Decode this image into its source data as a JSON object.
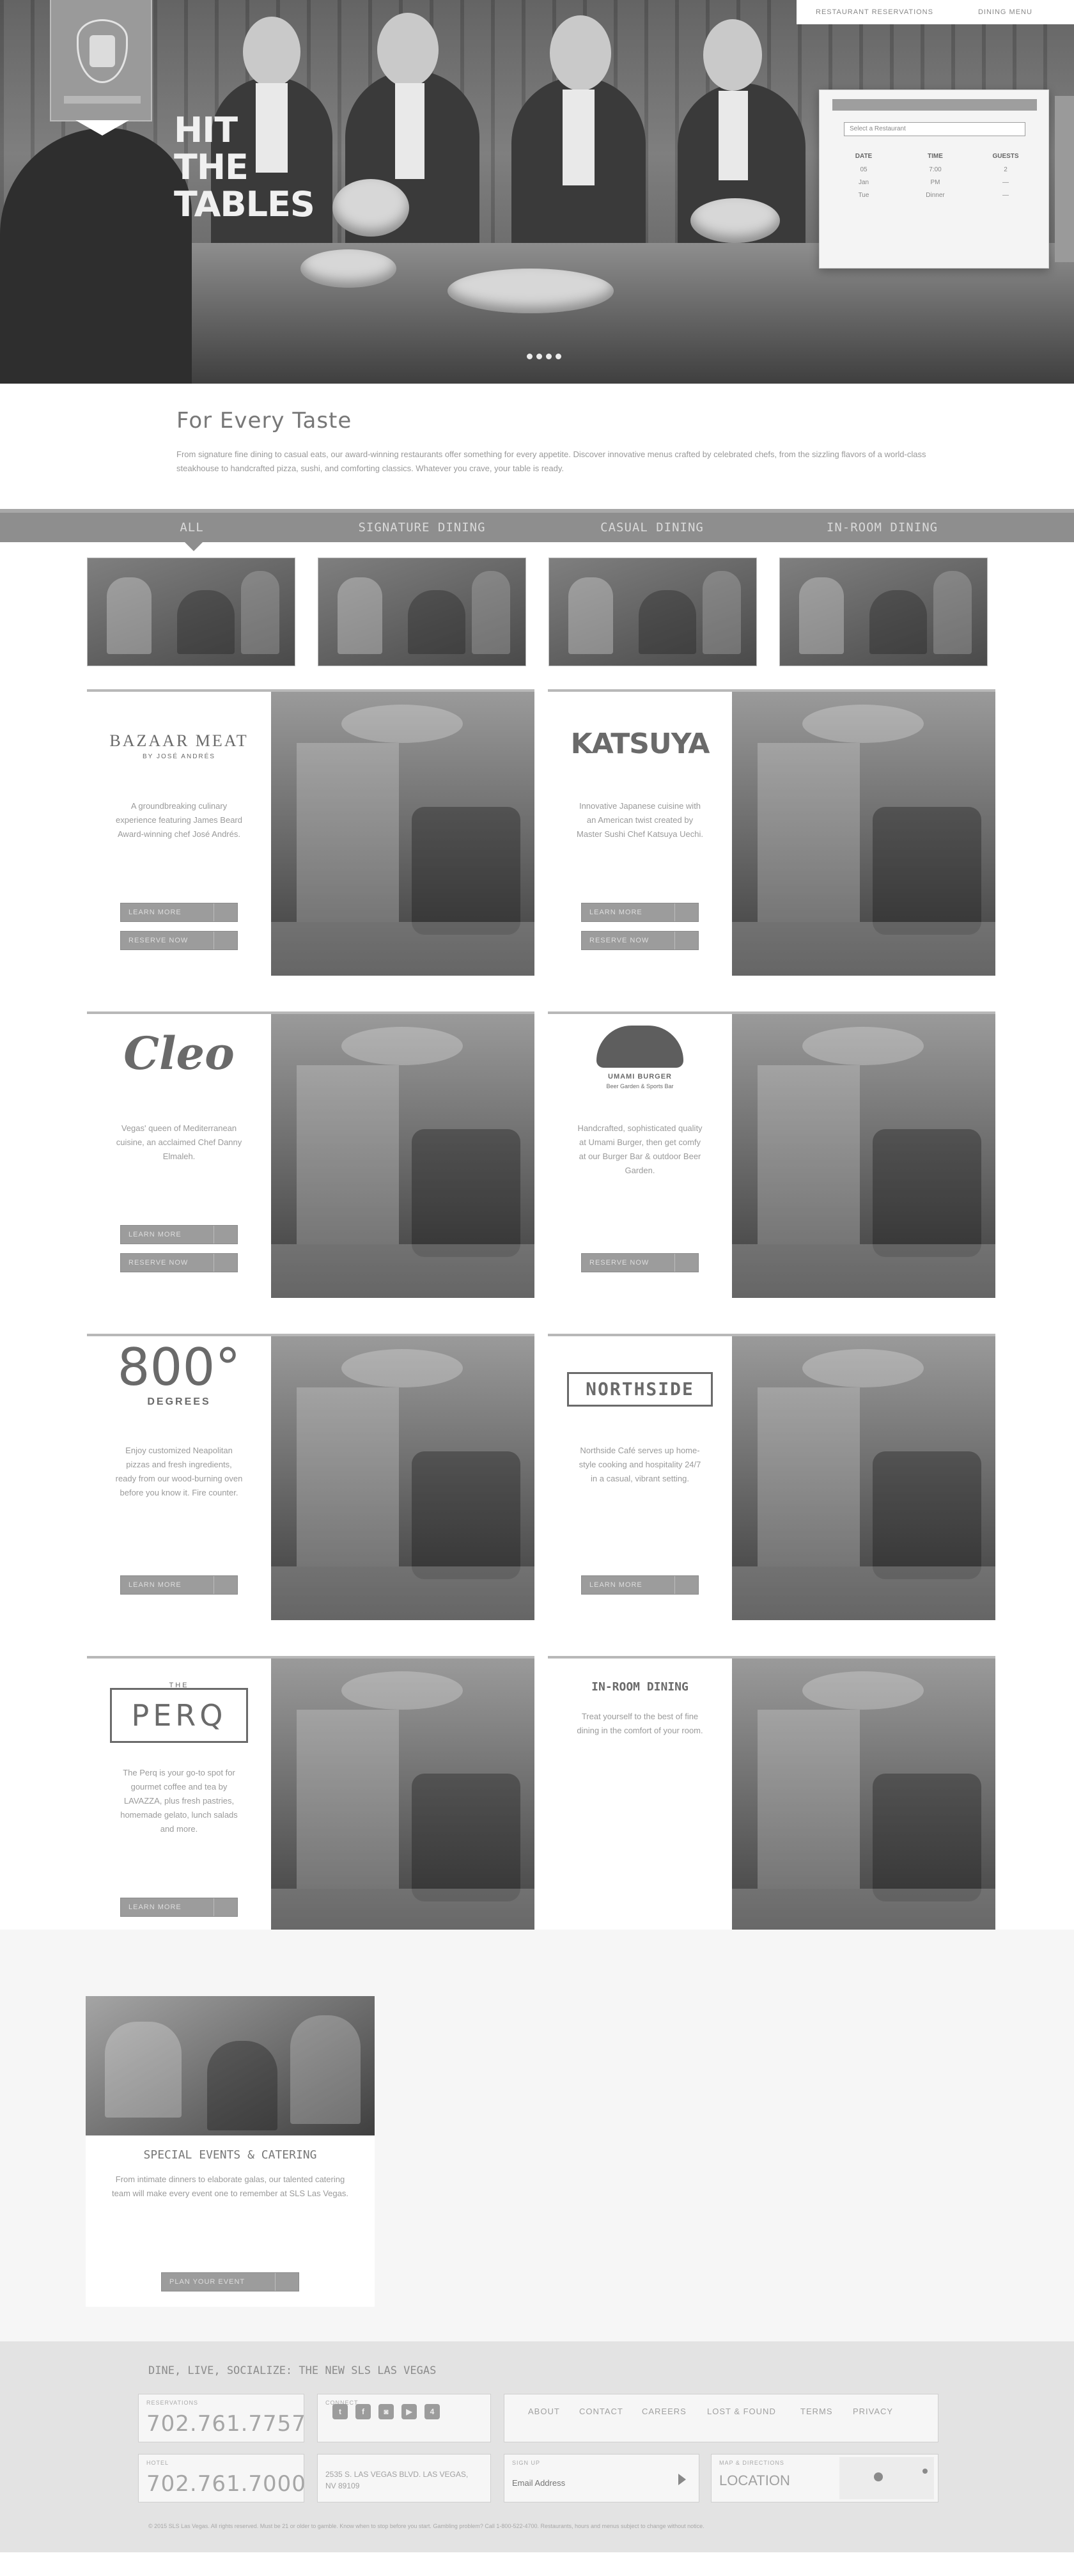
{
  "header": {
    "links": [
      "Restaurant Reservations",
      "Dining Menu"
    ],
    "hero_headline": [
      "HIT",
      "THE",
      "TABLES"
    ]
  },
  "reservation_widget": {
    "select_placeholder": "Select a Restaurant",
    "columns": [
      {
        "label": "Date",
        "values": [
          "05",
          "Jan",
          "Tue"
        ]
      },
      {
        "label": "Time",
        "values": [
          "7:00",
          "PM",
          "Dinner"
        ]
      },
      {
        "label": "Guests",
        "values": [
          "2",
          "—",
          "—"
        ]
      }
    ]
  },
  "intro": {
    "title": "For Every Taste",
    "text": "From signature fine dining to casual eats, our award-winning restaurants offer something for every appetite. Discover innovative menus crafted by celebrated chefs, from the sizzling flavors of a world-class steakhouse to handcrafted pizza, sushi, and comforting classics. Whatever you crave, your table is ready."
  },
  "filters": {
    "tabs": [
      "All",
      "Signature Dining",
      "Casual Dining",
      "In-Room Dining"
    ]
  },
  "restaurants": [
    {
      "logo": "BAZAAR MEAT",
      "logo_sub": "BY JOSÉ ANDRÉS",
      "description": "A groundbreaking culinary experience featuring James Beard Award-winning chef José Andrés.",
      "buttons": [
        "Learn More",
        "Reserve Now"
      ]
    },
    {
      "logo": "KATSUYA",
      "logo_sub": "",
      "description": "Innovative Japanese cuisine with an American twist created by Master Sushi Chef Katsuya Uechi.",
      "buttons": [
        "Learn More",
        "Reserve Now"
      ]
    },
    {
      "logo": "Cleo",
      "logo_sub": "",
      "description": "Vegas' queen of Mediterranean cuisine, an acclaimed Chef Danny Elmaleh.",
      "buttons": [
        "Learn More",
        "Reserve Now"
      ]
    },
    {
      "logo": "UMAMI BURGER",
      "logo_sub": "Beer Garden & Sports Bar",
      "description": "Handcrafted, sophisticated quality at Umami Burger, then get comfy at our Burger Bar & outdoor Beer Garden.",
      "buttons": [
        "Reserve Now"
      ]
    },
    {
      "logo": "800°",
      "logo_sub": "DEGREES",
      "description": "Enjoy customized Neapolitan pizzas and fresh ingredients, ready from our wood-burning oven before you know it. Fire counter.",
      "buttons": [
        "Learn More"
      ]
    },
    {
      "logo": "NORTHSIDE",
      "logo_sub": "",
      "description": "Northside Café serves up home-style cooking and hospitality 24/7 in a casual, vibrant setting.",
      "buttons": [
        "Learn More"
      ]
    },
    {
      "logo": "PERQ",
      "logo_sub": "THE",
      "description": "The Perq is your go-to spot for gourmet coffee and tea by LAVAZZA, plus fresh pastries, homemade gelato, lunch salads and more.",
      "buttons": [
        "Learn More"
      ]
    },
    {
      "logo": "IN-ROOM DINING",
      "logo_sub": "",
      "description": "Treat yourself to the best of fine dining in the comfort of your room.",
      "buttons": []
    }
  ],
  "events": {
    "title": "Special Events & Catering",
    "description": "From intimate dinners to elaborate galas, our talented catering team will make every event one to remember at SLS Las Vegas.",
    "button": "Plan Your Event"
  },
  "footer": {
    "tagline": "Dine, Live, Socialize: The New SLS Las Vegas",
    "reservations_label": "Reservations",
    "reservations_number": "702.761.7757",
    "hotel_label": "Hotel",
    "hotel_number": "702.761.7000",
    "connect_label": "Connect",
    "social": [
      "twitter-icon",
      "facebook-icon",
      "instagram-icon",
      "youtube-icon",
      "foursquare-icon"
    ],
    "nav": [
      "About",
      "Contact",
      "Careers",
      "Lost & Found",
      "Terms",
      "Privacy"
    ],
    "address": "2535 S. Las Vegas Blvd. Las Vegas, NV 89109",
    "newsletter_label": "Sign Up",
    "newsletter_placeholder": "Email Address",
    "location_label": "Map & Directions",
    "location_button": "LOCATION",
    "legal": "© 2015 SLS Las Vegas. All rights reserved. Must be 21 or older to gamble. Know when to stop before you start. Gambling problem? Call 1-800-522-4700. Restaurants, hours and menus subject to change without notice."
  }
}
